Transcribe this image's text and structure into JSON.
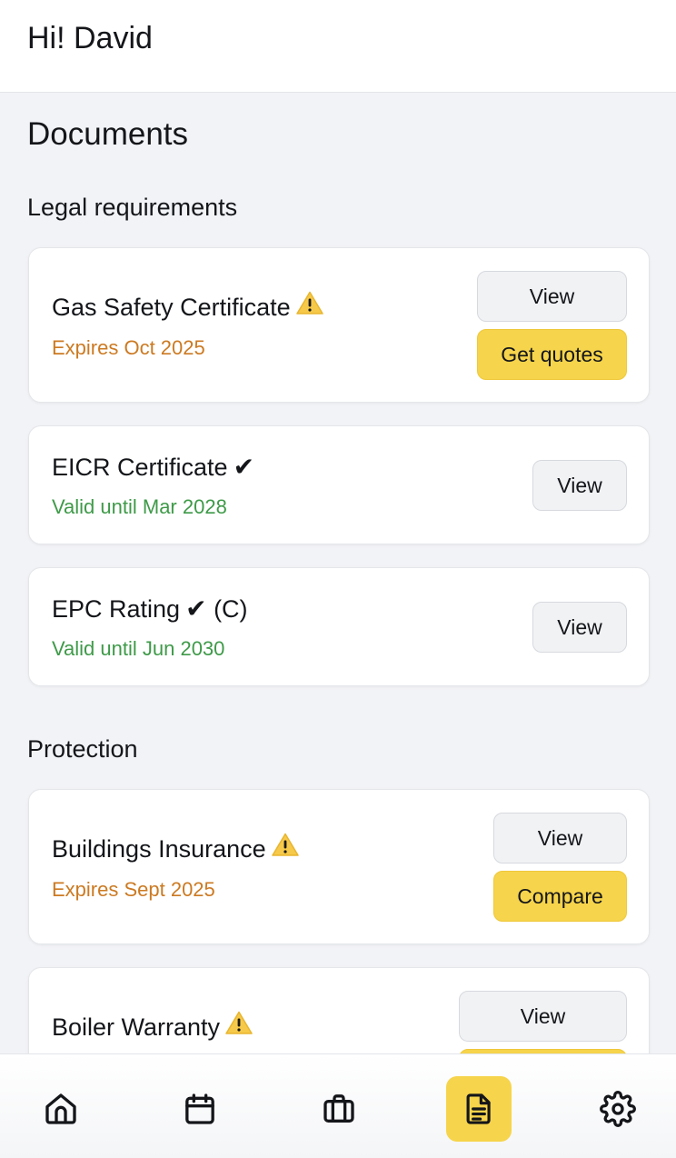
{
  "header": {
    "greeting": "Hi! David"
  },
  "page": {
    "title": "Documents"
  },
  "sections": {
    "legal": {
      "title": "Legal requirements",
      "items": [
        {
          "title": "Gas Safety Certificate",
          "status": "Expires Oct 2025",
          "status_type": "warning",
          "view_label": "View",
          "action_label": "Get quotes"
        },
        {
          "title": "EICR Certificate",
          "check": "✔",
          "status": "Valid until Mar 2028",
          "status_type": "ok",
          "view_label": "View"
        },
        {
          "title": "EPC Rating",
          "check": "✔",
          "suffix": "(C)",
          "status": "Valid until Jun 2030",
          "status_type": "ok",
          "view_label": "View"
        }
      ]
    },
    "protection": {
      "title": "Protection",
      "items": [
        {
          "title": "Buildings Insurance",
          "status": "Expires Sept 2025",
          "status_type": "warning",
          "view_label": "View",
          "action_label": "Compare"
        },
        {
          "title": "Boiler Warranty",
          "status_type": "warning",
          "view_label": "View"
        }
      ]
    }
  },
  "nav": {
    "items": [
      {
        "icon": "home-icon",
        "active": false
      },
      {
        "icon": "calendar-icon",
        "active": false
      },
      {
        "icon": "briefcase-icon",
        "active": false
      },
      {
        "icon": "document-icon",
        "active": true
      },
      {
        "icon": "gear-icon",
        "active": false
      }
    ]
  },
  "colors": {
    "accent": "#f6d44b",
    "warning": "#cc7a22",
    "ok": "#3e9a48",
    "background": "#f2f3f6"
  }
}
